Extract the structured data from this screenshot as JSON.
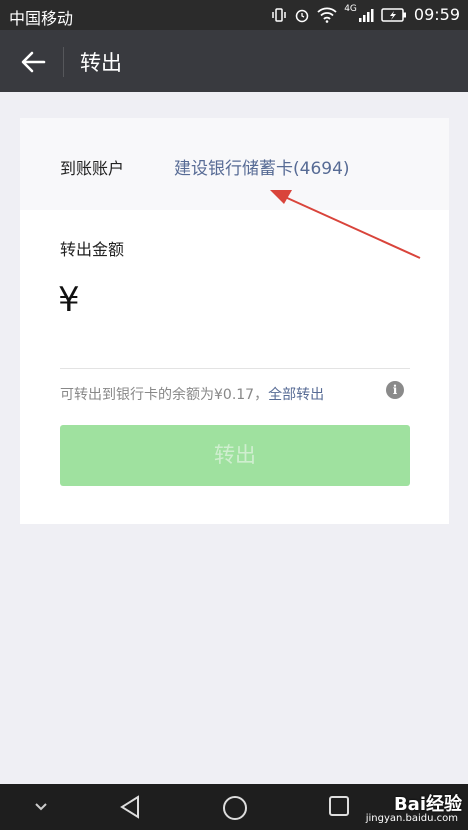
{
  "status": {
    "carrier": "中国移动",
    "network": "4G",
    "time": "09:59"
  },
  "header": {
    "title": "转出"
  },
  "form": {
    "account_label": "到账账户",
    "account_value": "建设银行储蓄卡(4694)",
    "amount_label": "转出金额",
    "currency": "¥",
    "amount_value": "",
    "balance_text": "可转出到银行卡的余额为¥0.17，",
    "all_out_link": "全部转出",
    "confirm_label": "转出"
  },
  "watermark": {
    "brand": "Bai经验",
    "url": "jingyan.baidu.com"
  },
  "colors": {
    "title_bar": "#393a3f",
    "link_blue": "#576b95",
    "button_disabled": "#9fe19f"
  }
}
